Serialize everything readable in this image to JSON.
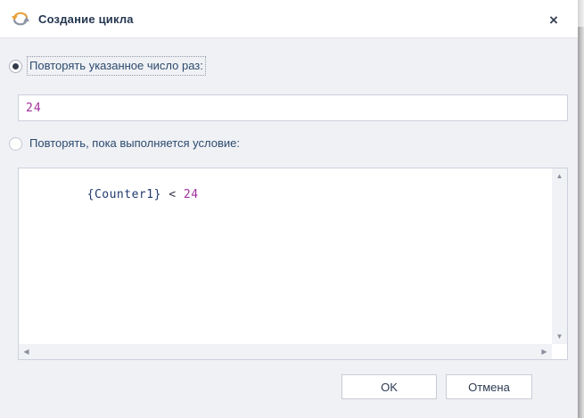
{
  "window": {
    "title": "Создание цикла",
    "close_glyph": "×"
  },
  "options": {
    "repeat_count": {
      "label": "Повторять указанное число раз:",
      "selected": true
    },
    "repeat_condition": {
      "label": "Повторять, пока выполняется условие:",
      "selected": false
    }
  },
  "count_input": {
    "value": "24",
    "placeholder": ""
  },
  "condition_editor": {
    "tokens": [
      {
        "text": "{Counter1}",
        "type": "identifier"
      },
      {
        "text": " < ",
        "type": "operator"
      },
      {
        "text": "24",
        "type": "number"
      }
    ],
    "scroll_glyphs": {
      "up": "▲",
      "down": "▼",
      "left": "◀",
      "right": "▶"
    }
  },
  "buttons": {
    "ok": "OK",
    "cancel": "Отмена"
  },
  "colors": {
    "title_text": "#24364f",
    "label_text": "#2b4a6e",
    "token_identifier": "#1f3a6d",
    "token_operator": "#333344",
    "token_number": "#a2309f",
    "icon_orange": "#e9a13b",
    "icon_gray": "#8c93a3",
    "body_bg": "#f0f1f5",
    "field_border": "#ccd1dc"
  }
}
